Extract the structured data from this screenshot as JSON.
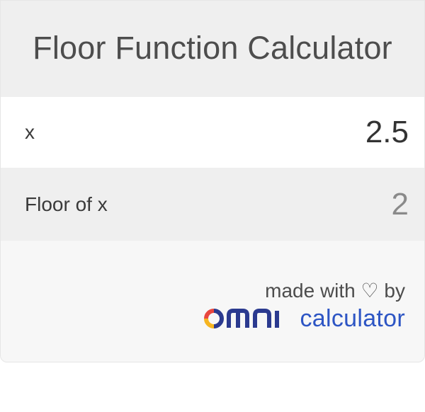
{
  "header": {
    "title": "Floor Function Calculator"
  },
  "input": {
    "label": "x",
    "value": "2.5"
  },
  "result": {
    "label": "Floor of x",
    "value": "2"
  },
  "footer": {
    "made_with": "made with ♡ by",
    "brand_logo": "omni",
    "brand_word": "calculator"
  },
  "colors": {
    "brand_blue": "#2d55c4",
    "logo_red": "#e8473f",
    "logo_yellow": "#f6b521",
    "logo_navy": "#2b3a8f"
  },
  "icons": [
    "omni-logo-icon"
  ]
}
